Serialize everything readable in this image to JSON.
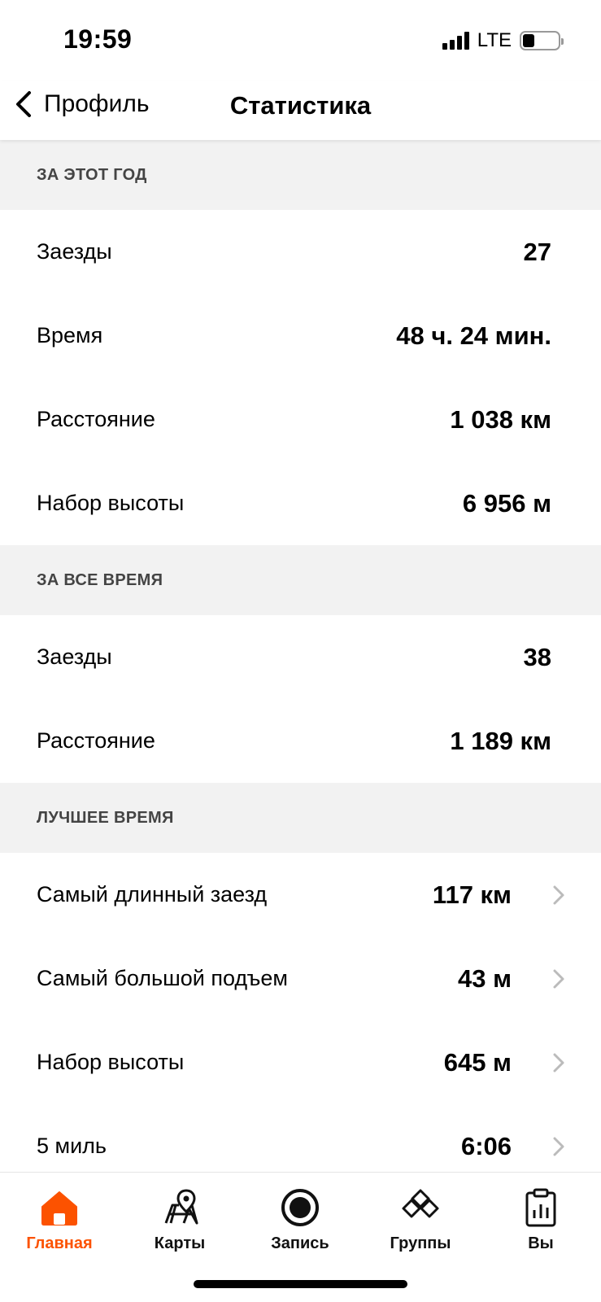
{
  "status_bar": {
    "time": "19:59",
    "network": "LTE"
  },
  "nav": {
    "back_label": "Профиль",
    "title": "Статистика"
  },
  "sections": {
    "this_year": {
      "header": "ЗА ЭТОТ ГОД",
      "rows": [
        {
          "label": "Заезды",
          "value": "27"
        },
        {
          "label": "Время",
          "value": "48 ч. 24 мин."
        },
        {
          "label": "Расстояние",
          "value": "1 038 км"
        },
        {
          "label": "Набор высоты",
          "value": "6 956 м"
        }
      ]
    },
    "all_time": {
      "header": "ЗА ВСЕ ВРЕМЯ",
      "rows": [
        {
          "label": "Заезды",
          "value": "38"
        },
        {
          "label": "Расстояние",
          "value": "1 189 км"
        }
      ]
    },
    "best": {
      "header": "ЛУЧШЕЕ ВРЕМЯ",
      "rows": [
        {
          "label": "Самый длинный заезд",
          "value": "117 км"
        },
        {
          "label": "Самый большой подъем",
          "value": "43 м"
        },
        {
          "label": "Набор высоты",
          "value": "645 м"
        },
        {
          "label": "5 миль",
          "value": "6:06"
        }
      ]
    }
  },
  "tabs": [
    {
      "label": "Главная",
      "icon": "home-icon",
      "active": true
    },
    {
      "label": "Карты",
      "icon": "map-icon",
      "active": false
    },
    {
      "label": "Запись",
      "icon": "record-icon",
      "active": false
    },
    {
      "label": "Группы",
      "icon": "groups-icon",
      "active": false
    },
    {
      "label": "Вы",
      "icon": "profile-icon",
      "active": false
    }
  ],
  "colors": {
    "accent": "#fc5200",
    "section_bg": "#f2f2f2"
  }
}
